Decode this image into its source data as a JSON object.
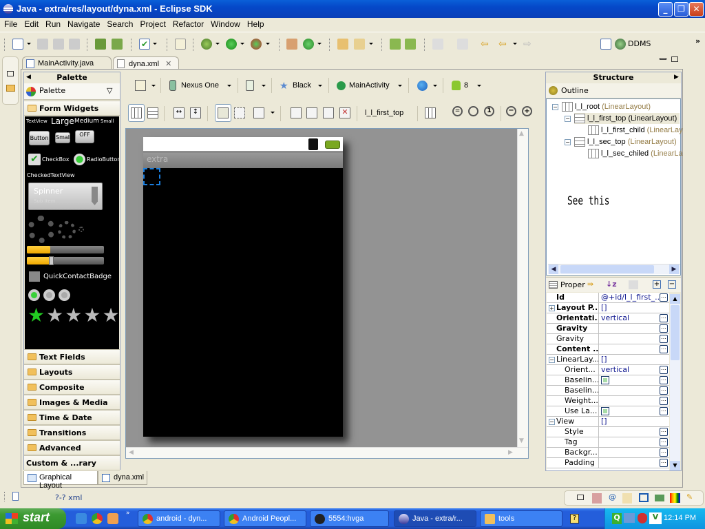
{
  "window": {
    "title": "Java - extra/res/layout/dyna.xml - Eclipse SDK",
    "minimize": "_",
    "restore": "❐",
    "close": "✕"
  },
  "menu": [
    "File",
    "Edit",
    "Run",
    "Navigate",
    "Search",
    "Project",
    "Refactor",
    "Window",
    "Help"
  ],
  "toolbar": {
    "ddms_label": "DDMS",
    "overflow": "»"
  },
  "editor_tabs": [
    {
      "label": "MainActivity.java"
    },
    {
      "label": "dyna.xml",
      "close": "✕"
    }
  ],
  "palette": {
    "title": "Palette",
    "dropdown": "Palette",
    "open_category": "Form Widgets",
    "widgets": {
      "text_sizes": [
        "TextView",
        "Large",
        "Medium",
        "Small"
      ],
      "buttons": [
        "Button",
        "Small",
        "OFF"
      ],
      "checkbox": "CheckBox",
      "radio": "RadioButton",
      "checked_text": "CheckedTextView",
      "spinner": "Spinner",
      "spinner_sub": "Sub Item",
      "progress_fraction": 0.3,
      "seekbar_fraction": 0.3,
      "quick_contact": "QuickContactBadge",
      "rating_stars_filled": 1
    },
    "categories": [
      "Text Fields",
      "Layouts",
      "Composite",
      "Images & Media",
      "Time & Date",
      "Transitions",
      "Advanced",
      "Custom & ...rary Views"
    ]
  },
  "canvas_toolbar": {
    "device": "Nexus One",
    "theme": "Black",
    "activity": "MainActivity",
    "api_level": "8",
    "selected_element": "l_l_first_top"
  },
  "device_preview": {
    "app_title": "extra"
  },
  "bottom_tabs": [
    "Graphical Layout",
    "dyna.xml"
  ],
  "structure": {
    "title": "Structure",
    "outline_tab": "Outline",
    "tree": [
      {
        "name": "l_l_root",
        "type": "(LinearLayout)"
      },
      {
        "name": "l_l_first_top",
        "type": "(LinearLayout)",
        "selected": true
      },
      {
        "name": "l_l_first_child",
        "type": "(LinearLay"
      },
      {
        "name": "l_l_sec_top",
        "type": "(LinearLayout)"
      },
      {
        "name": "l_l_sec_chiled",
        "type": "(LinearLa"
      }
    ],
    "annotation": "See this",
    "properties_tab": "Proper",
    "properties": [
      {
        "key": "Id",
        "value": "@+id/l_l_first_...",
        "bold": true,
        "dots": true
      },
      {
        "key": "Layout P...",
        "value": "[]",
        "bold": true,
        "expand": "+"
      },
      {
        "key": "Orientati...",
        "value": "vertical",
        "bold": true,
        "dots": true
      },
      {
        "key": "Gravity",
        "value": "",
        "bold": true,
        "dots": true
      },
      {
        "key": "Gravity",
        "value": "",
        "dots": true
      },
      {
        "key": "Content ...",
        "value": "",
        "bold": true,
        "dots": true
      },
      {
        "key": "LinearLay...",
        "value": "[]",
        "expand": "−"
      },
      {
        "key": "Orient...",
        "value": "vertical",
        "indent": true,
        "dots": true
      },
      {
        "key": "Baselin...",
        "value": "",
        "indent": true,
        "check": true,
        "dots": true
      },
      {
        "key": "Baselin...",
        "value": "",
        "indent": true,
        "dots": true
      },
      {
        "key": "Weight...",
        "value": "",
        "indent": true,
        "dots": true
      },
      {
        "key": "Use La...",
        "value": "",
        "indent": true,
        "check": true,
        "dots": true
      },
      {
        "key": "View",
        "value": "[]",
        "expand": "−"
      },
      {
        "key": "Style",
        "value": "",
        "indent": true,
        "dots": true
      },
      {
        "key": "Tag",
        "value": "",
        "indent": true,
        "dots": true
      },
      {
        "key": "Backgr...",
        "value": "",
        "indent": true,
        "dots": true
      },
      {
        "key": "Padding",
        "value": "",
        "indent": true,
        "dots": true
      }
    ]
  },
  "statusbar": {
    "text": "?-? xml"
  },
  "taskbar": {
    "start": "start",
    "tasks": [
      {
        "label": "android - dyn...",
        "icon": "chrome-icon"
      },
      {
        "label": "Android Peopl...",
        "icon": "chrome-icon"
      },
      {
        "label": "5554:hvga",
        "icon": "emulator-icon"
      },
      {
        "label": "Java - extra/r...",
        "icon": "eclipse-icon",
        "active": true
      },
      {
        "label": "tools",
        "icon": "folder-icon"
      }
    ],
    "clock": "12:14 PM"
  }
}
